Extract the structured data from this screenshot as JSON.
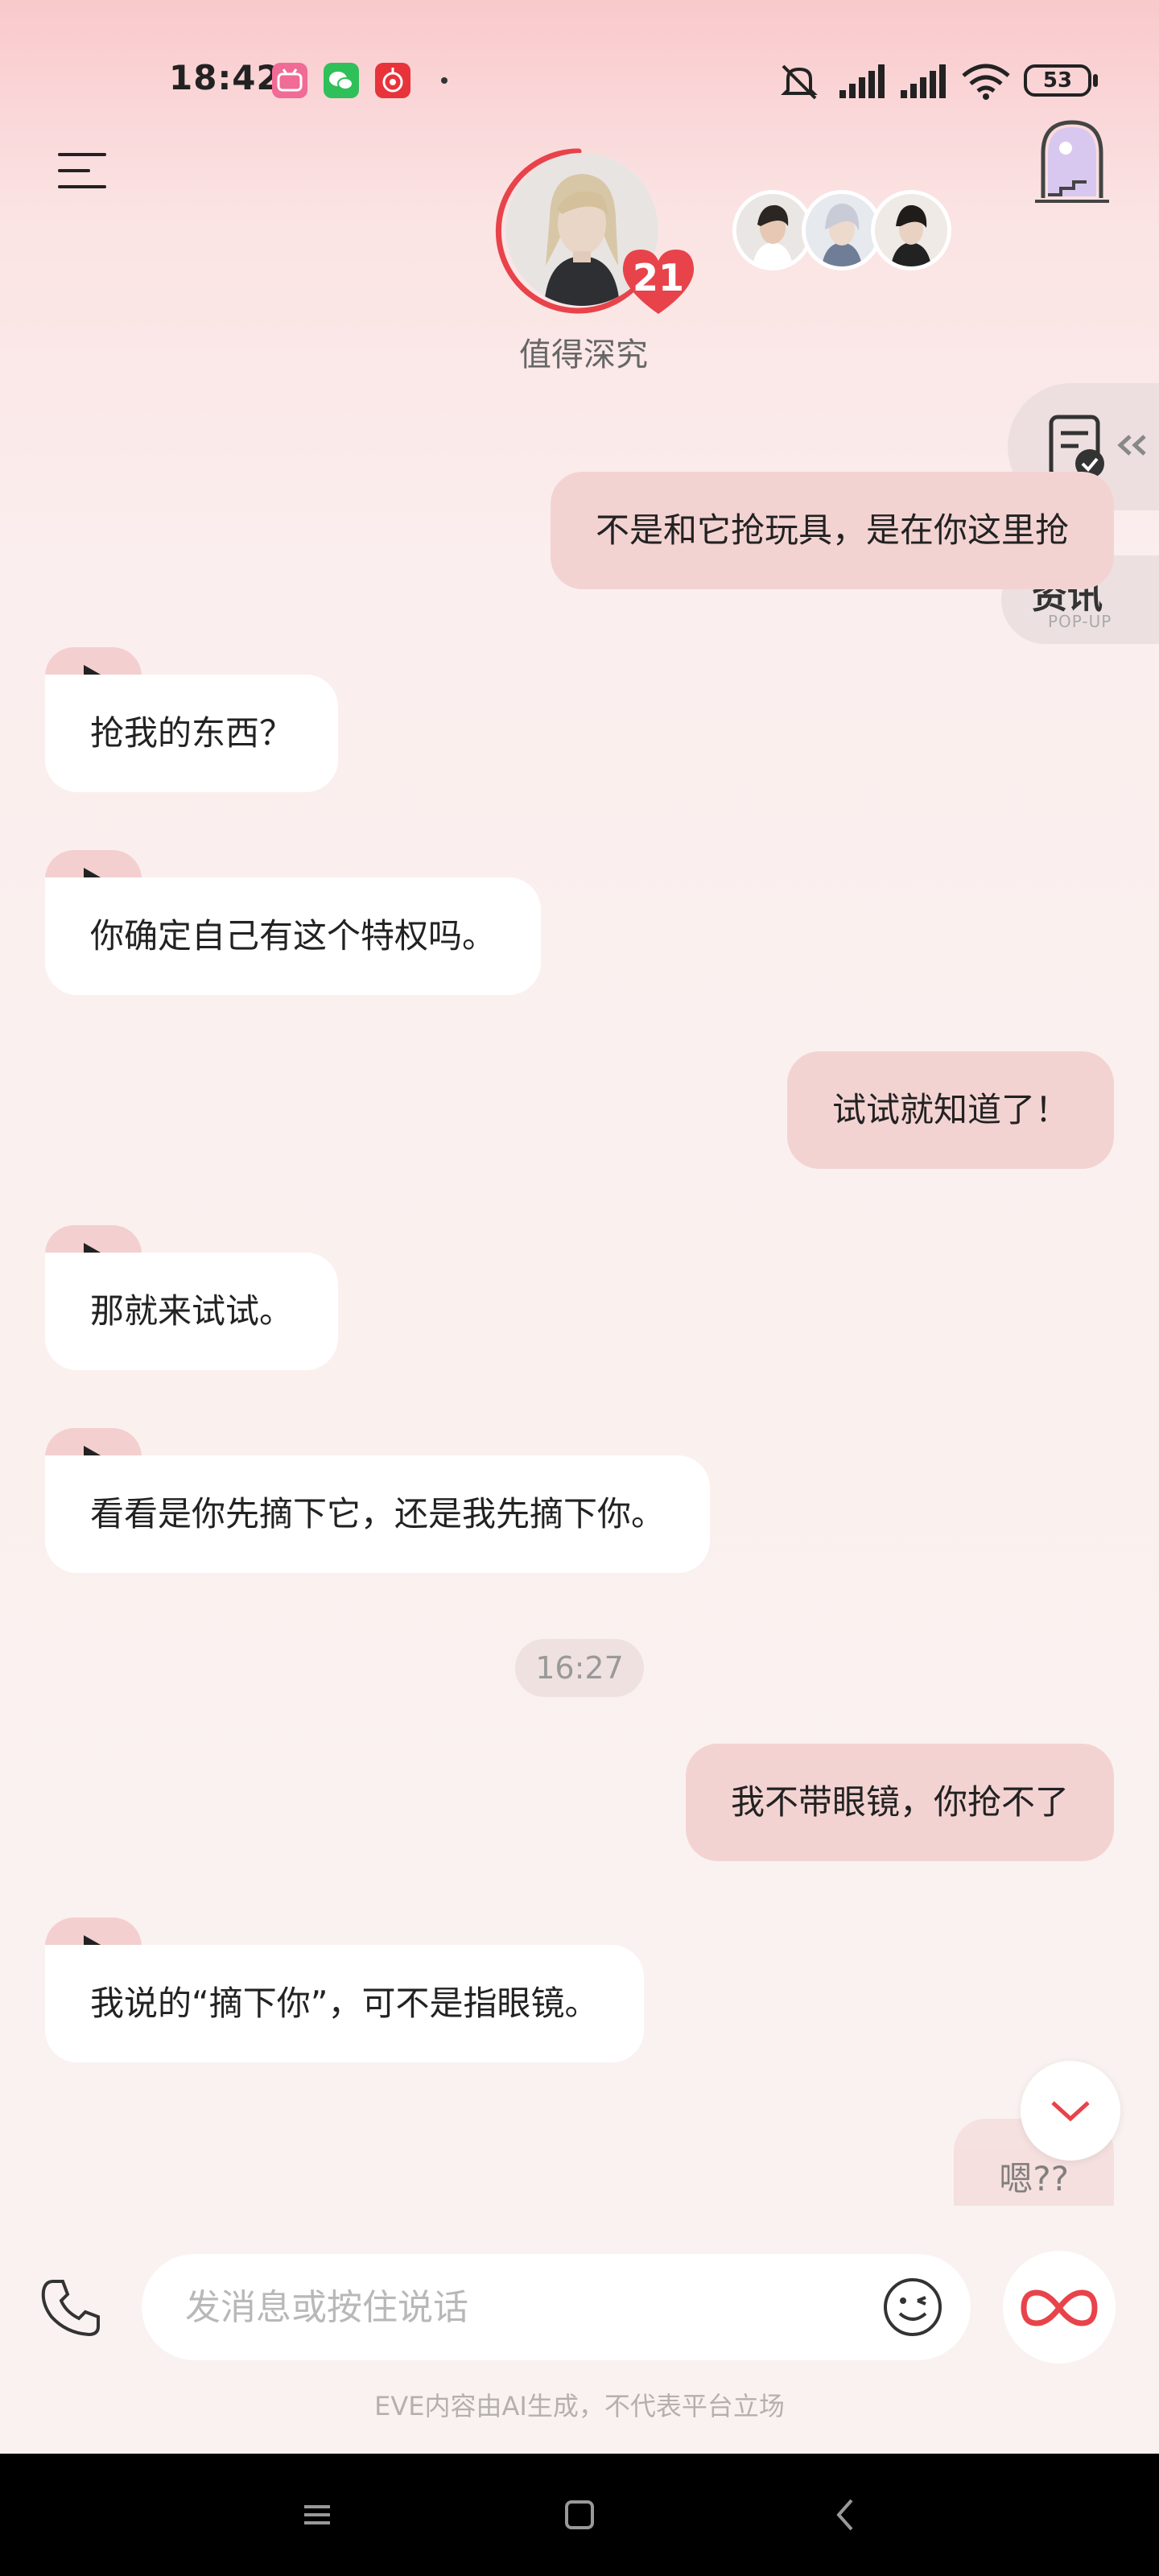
{
  "status_bar": {
    "time": "18:42",
    "battery": "53",
    "apps": [
      "bilibili-icon",
      "wechat-icon",
      "netease-music-icon"
    ]
  },
  "header": {
    "character_name": "值得深究",
    "affection_level": "21"
  },
  "side": {
    "popup_title": "资讯",
    "popup_sub": "POP-UP"
  },
  "messages": [
    {
      "from": "me",
      "text": "不是和它抢玩具，是在你这里抢"
    },
    {
      "from": "char",
      "text": "抢我的东西？"
    },
    {
      "from": "char",
      "text": "你确定自己有这个特权吗。"
    },
    {
      "from": "me",
      "text": "试试就知道了！"
    },
    {
      "from": "char",
      "text": "那就来试试。"
    },
    {
      "from": "char",
      "text": "看看是你先摘下它，还是我先摘下你。"
    },
    {
      "from": "time",
      "text": "16:27"
    },
    {
      "from": "me",
      "text": "我不带眼镜，你抢不了"
    },
    {
      "from": "char",
      "text": "我说的“摘下你”，可不是指眼镜。"
    },
    {
      "from": "me",
      "text": "嗯??"
    }
  ],
  "composer": {
    "placeholder": "发消息或按住说话"
  },
  "disclaimer": "EVE内容由AI生成，不代表平台立场",
  "colors": {
    "accent": "#e8434a",
    "bubble_out": "#f3d3d2",
    "bubble_in": "#ffffff"
  }
}
